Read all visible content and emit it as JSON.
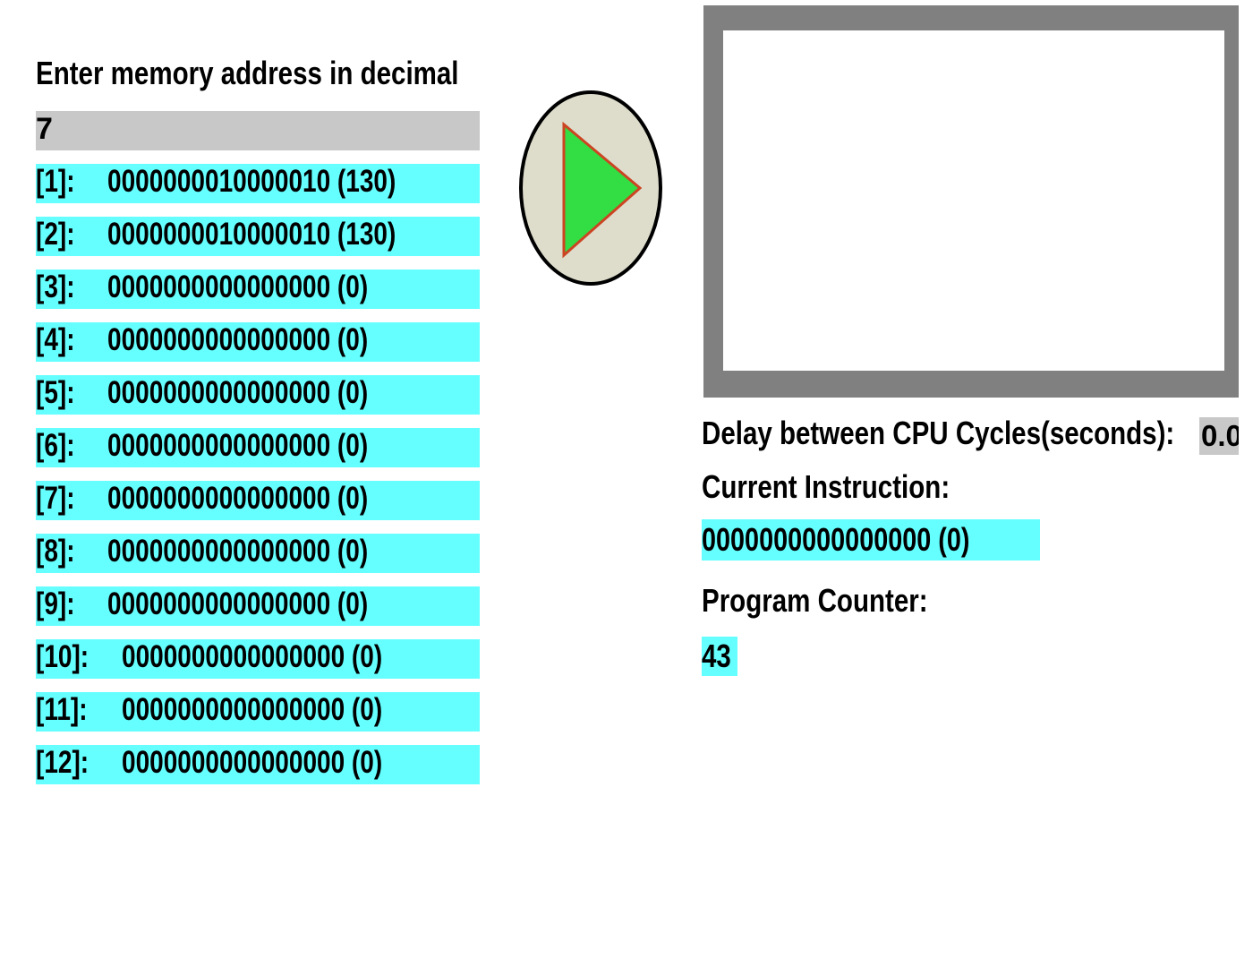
{
  "memory_panel": {
    "address_label": "Enter memory address in decimal",
    "address_value": "7",
    "rows": [
      {
        "index": "[1]:",
        "value": "0000000010000010 (130)"
      },
      {
        "index": "[2]:",
        "value": "0000000010000010 (130)"
      },
      {
        "index": "[3]:",
        "value": "0000000000000000 (0)"
      },
      {
        "index": "[4]:",
        "value": "0000000000000000 (0)"
      },
      {
        "index": "[5]:",
        "value": "0000000000000000 (0)"
      },
      {
        "index": "[6]:",
        "value": "0000000000000000 (0)"
      },
      {
        "index": "[7]:",
        "value": "0000000000000000 (0)"
      },
      {
        "index": "[8]:",
        "value": "0000000000000000 (0)"
      },
      {
        "index": "[9]:",
        "value": "0000000000000000 (0)"
      },
      {
        "index": "[10]:",
        "value": "0000000000000000 (0)"
      },
      {
        "index": "[11]:",
        "value": "0000000000000000 (0)"
      },
      {
        "index": "[12]:",
        "value": "0000000000000000 (0)"
      }
    ]
  },
  "play_button": {
    "icon": "play-icon",
    "colors": {
      "fill": "#33dd44",
      "outline": "#cc4422",
      "background": "#deddcc"
    }
  },
  "cpu_panel": {
    "delay_label": "Delay between CPU Cycles(seconds):",
    "delay_value": "0.0",
    "current_instruction_label": "Current Instruction:",
    "current_instruction_value": "0000000000000000 (0)",
    "program_counter_label": "Program Counter:",
    "program_counter_value": "43"
  },
  "colors": {
    "row_highlight": "#66ffff",
    "input_background": "#c8c8c8",
    "screen_frame": "#808080"
  }
}
